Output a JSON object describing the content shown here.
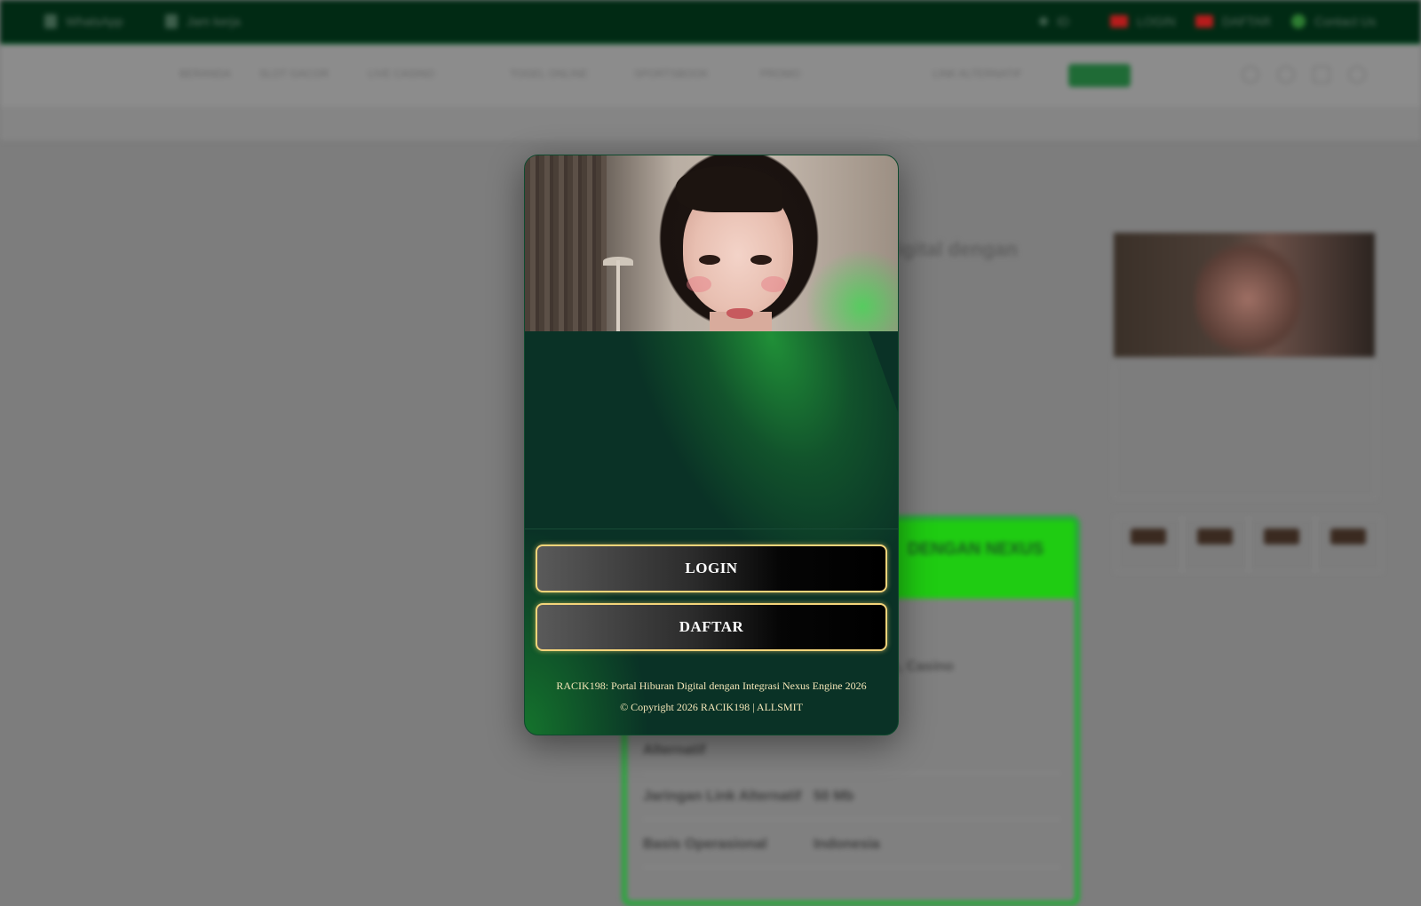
{
  "topbar": {
    "items": [
      {
        "label": "WhatsApp"
      },
      {
        "label": "Jam kerja"
      }
    ],
    "right": [
      {
        "label": "ID"
      },
      {
        "label": "LOGIN"
      },
      {
        "label": "DAFTAR"
      },
      {
        "label": "Contact Us"
      }
    ]
  },
  "nav": {
    "links": [
      "BERANDA",
      "SLOT GACOR",
      "LIVE CASINO",
      "TOGEL ONLINE",
      "SPORTSBOOK",
      "PROMO",
      "LINK ALTERNATIF"
    ],
    "cta_label": ""
  },
  "background": {
    "title_fragment": "igital dengan",
    "card_heading": "DENGAN NEXUS",
    "card_tail": "Togel Online, Casino",
    "rows": [
      {
        "label": "Jaringan Link Alternatif",
        "value": "50 Mb"
      },
      {
        "label": "Basis Operasional",
        "value": "Indonesia"
      }
    ],
    "row_wrap": "Alternatif"
  },
  "modal": {
    "login_label": "LOGIN",
    "daftar_label": "DAFTAR",
    "footer_title": "RACIK198: Portal Hiburan Digital dengan Integrasi Nexus Engine 2026",
    "footer_copyright": "© Copyright 2026 RACIK198 | ALLSMIT"
  },
  "colors": {
    "topbar": "#012a14",
    "modal_bg": "#0a3226",
    "button_border": "#f4d47a",
    "accent_green": "#1fcc12"
  },
  "icons": [
    "whatsapp-icon",
    "clock-icon",
    "flag-icon",
    "search-icon",
    "heart-icon",
    "cart-icon",
    "user-icon"
  ]
}
